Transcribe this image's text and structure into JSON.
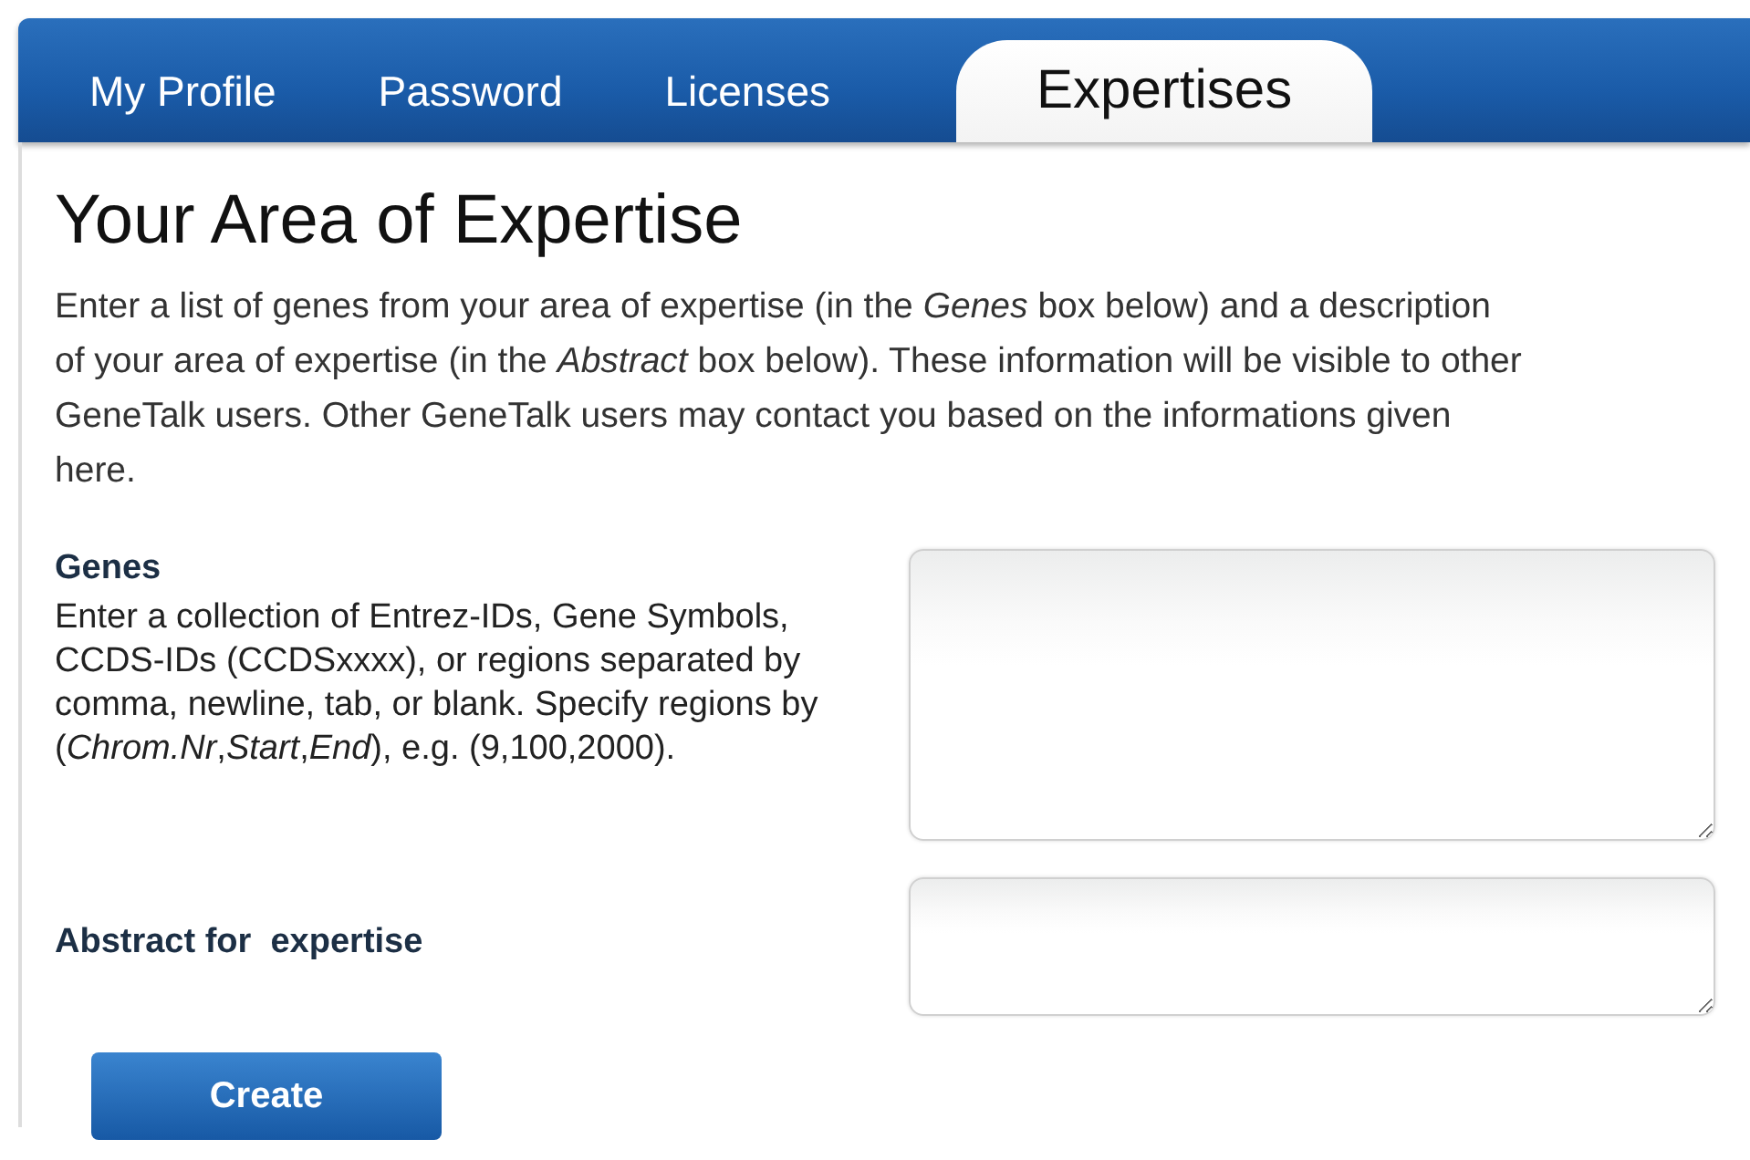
{
  "tabs": [
    {
      "label": "My Profile",
      "selected": false
    },
    {
      "label": "Password",
      "selected": false
    },
    {
      "label": "Licenses",
      "selected": false
    },
    {
      "label": "Expertises",
      "selected": true
    }
  ],
  "heading": "Your Area of Expertise",
  "intro": "Enter a list of genes from your area of expertise (in the *Genes* box below) and a description of your area of expertise (in the *Abstract* box below). These information will be visible to other GeneTalk users. Other GeneTalk users may contact you based on the informations given here.",
  "fields": [
    {
      "label": "Genes",
      "help": "Enter a collection of Entrez-IDs, Gene Symbols, CCDS-IDs (CCDSxxxx), or regions separated by comma, newline, tab, or blank. Specify regions by (*Chrom.Nr*,*Start*,*End*), e.g. (9,100,2000)."
    },
    {
      "label": "Abstract for  expertise"
    }
  ],
  "button": "Create"
}
